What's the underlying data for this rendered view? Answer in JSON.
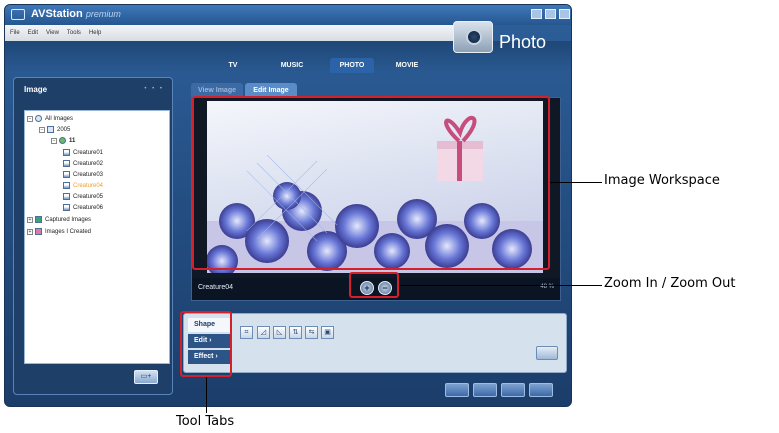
{
  "app": {
    "title": "AVStation",
    "title_suffix": "premium",
    "menu": [
      "File",
      "Edit",
      "View",
      "Tools",
      "Help"
    ],
    "nav_tabs": [
      "TV",
      "MUSIC",
      "PHOTO",
      "MOVIE"
    ],
    "active_nav_tab": "PHOTO",
    "section_title": "Photo"
  },
  "left_panel": {
    "title": "Image",
    "tree": [
      {
        "label": "All Images",
        "level": 0,
        "expander": "−"
      },
      {
        "label": "2005",
        "level": 1,
        "expander": "−"
      },
      {
        "label": "11",
        "level": 2,
        "expander": "−"
      },
      {
        "label": "Creature01",
        "level": 3
      },
      {
        "label": "Creature02",
        "level": 3
      },
      {
        "label": "Creature03",
        "level": 3
      },
      {
        "label": "Creature04",
        "level": 3,
        "selected": true
      },
      {
        "label": "Creature05",
        "level": 3
      },
      {
        "label": "Creature06",
        "level": 3
      },
      {
        "label": "Captured Images",
        "level": 0,
        "expander": "+"
      },
      {
        "label": "Images I Created",
        "level": 0,
        "expander": "+"
      }
    ],
    "new_folder_icon": "new-folder-icon"
  },
  "viewer": {
    "tabs": [
      "View Image",
      "Edit Image"
    ],
    "active_tab": "Edit Image",
    "image_name": "Creature04",
    "zoom_level": "48 %",
    "zoom_in_label": "+",
    "zoom_out_label": "−"
  },
  "tools": {
    "tabs": [
      "Shape",
      "Edit ›",
      "Effect ›"
    ],
    "active_tab": "Shape",
    "buttons": [
      "crop-icon",
      "rotate-left-icon",
      "rotate-right-icon",
      "flip-vertical-icon",
      "flip-horizontal-icon",
      "resize-icon"
    ],
    "button_glyphs": [
      "⌗",
      "◿",
      "◺",
      "⇅",
      "⇆",
      "▣"
    ],
    "apply_icon": "apply-icon"
  },
  "bottom_buttons": [
    "",
    "",
    "",
    ""
  ],
  "callouts": {
    "workspace": "Image Workspace",
    "zoom": "Zoom In / Zoom Out",
    "tool_tabs": "Tool Tabs"
  },
  "colors": {
    "highlight": "#d3202a",
    "app_blue": "#1b3d6a",
    "selected_item": "#f0a030"
  }
}
